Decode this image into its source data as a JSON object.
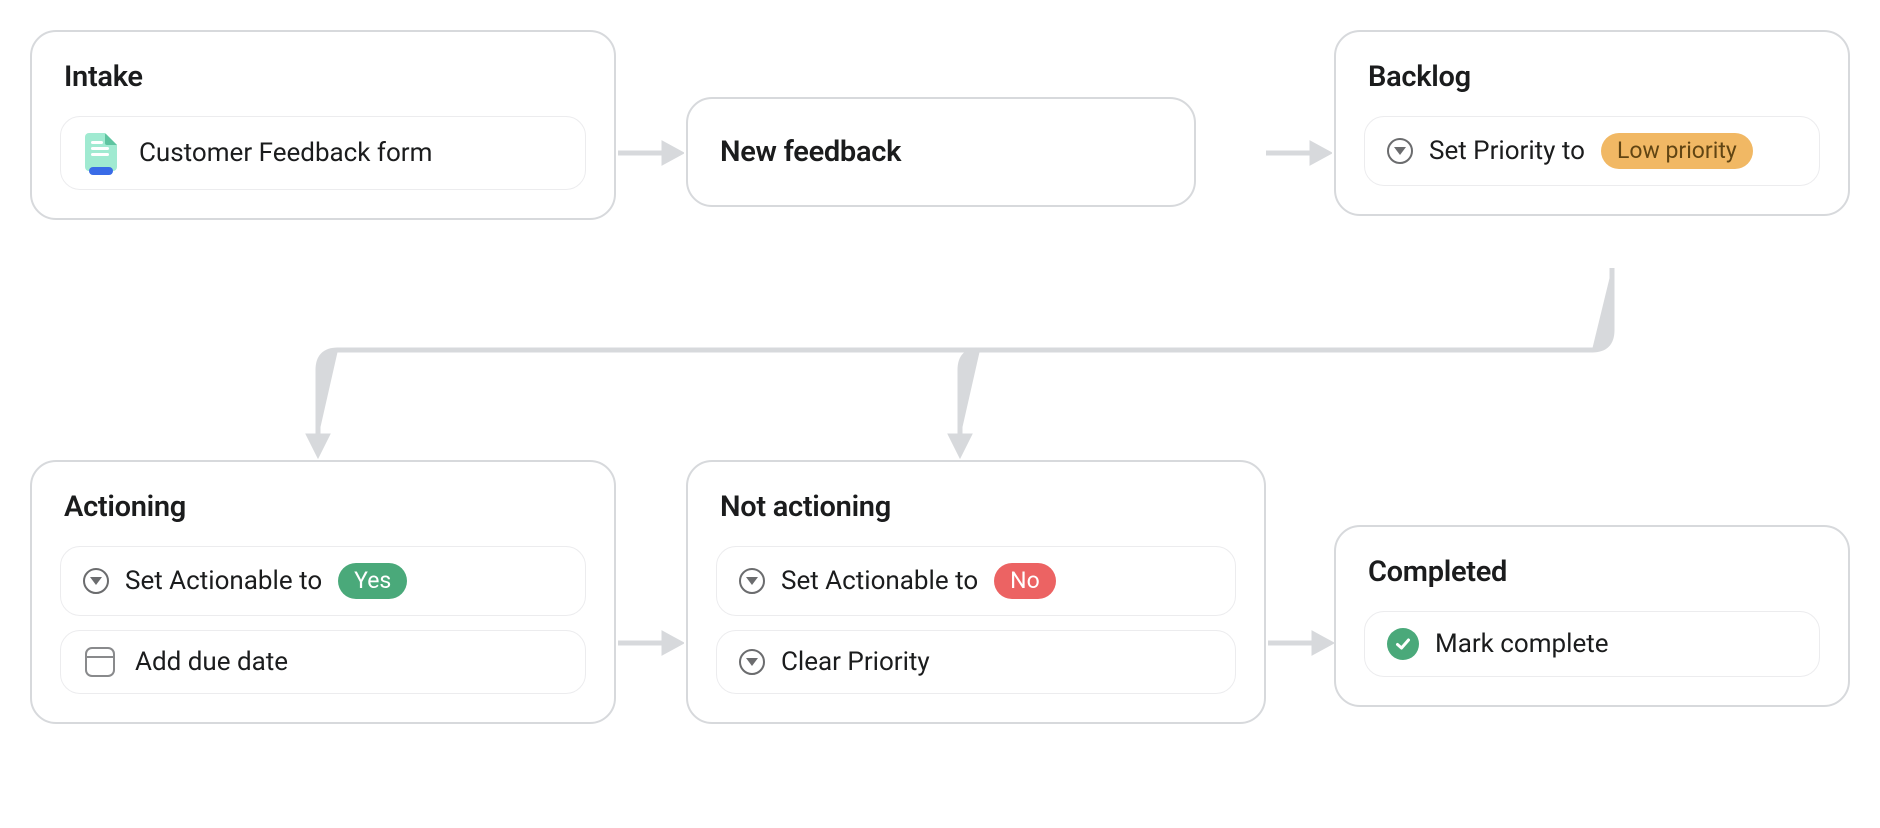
{
  "cards": {
    "intake": {
      "title": "Intake",
      "form_label": "Customer Feedback form"
    },
    "new_feedback": {
      "title": "New feedback"
    },
    "backlog": {
      "title": "Backlog",
      "rule_prefix": "Set Priority to",
      "rule_tag": "Low priority"
    },
    "actioning": {
      "title": "Actioning",
      "rule1_prefix": "Set Actionable to",
      "rule1_tag": "Yes",
      "rule2": "Add due date"
    },
    "not_actioning": {
      "title": "Not actioning",
      "rule1_prefix": "Set Actionable to",
      "rule1_tag": "No",
      "rule2": "Clear Priority"
    },
    "completed": {
      "title": "Completed",
      "rule1": "Mark complete"
    }
  }
}
